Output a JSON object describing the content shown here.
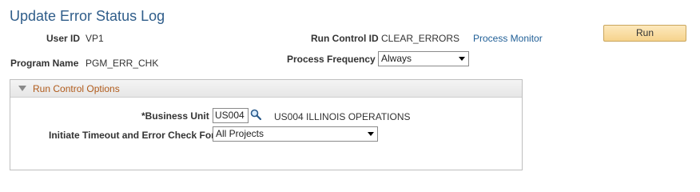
{
  "page": {
    "title": "Update Error Status Log"
  },
  "header": {
    "user_id_label": "User ID",
    "user_id_value": "VP1",
    "run_control_label": "Run Control ID",
    "run_control_value": "CLEAR_ERRORS",
    "process_monitor_link": "Process Monitor",
    "run_button": "Run",
    "program_name_label": "Program Name",
    "program_name_value": "PGM_ERR_CHK",
    "process_frequency_label": "Process Frequency",
    "process_frequency_value": "Always"
  },
  "options": {
    "section_title": "Run Control Options",
    "business_unit_label": "*Business Unit",
    "business_unit_value": "US004",
    "business_unit_description": "US004 ILLINOIS OPERATIONS",
    "timeout_label": "Initiate Timeout and Error Check For",
    "timeout_value": "All Projects"
  },
  "icons": {
    "lookup": "magnifier-icon",
    "dropdown": "chevron-down-icon",
    "collapse": "triangle-down-icon"
  },
  "colors": {
    "title": "#2f5d8a",
    "link": "#1f5e96",
    "section_title": "#b05a1a",
    "run_button": "#f6d38c"
  }
}
